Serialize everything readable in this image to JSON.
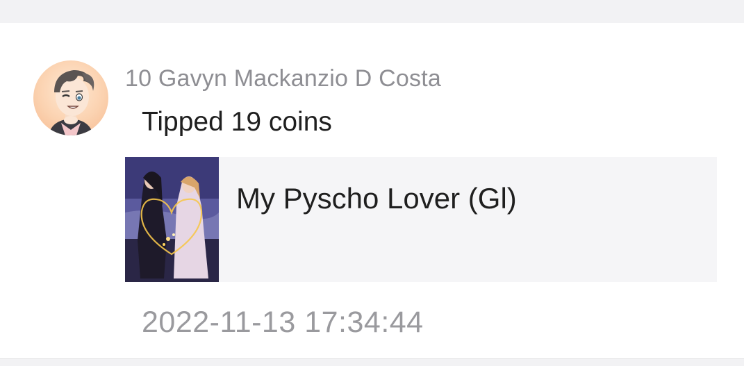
{
  "tip_item": {
    "user": {
      "name": "10 Gavyn Mackanzio D Costa",
      "avatar_icon": "cartoon-avatar-icon"
    },
    "message": "Tipped 19 coins",
    "book": {
      "title": "My Pyscho Lover (Gl)",
      "cover_icon": "book-cover-art"
    },
    "timestamp": "2022-11-13 17:34:44"
  },
  "colors": {
    "background": "#ffffff",
    "band": "#f2f2f4",
    "card": "#f5f5f7",
    "muted_text": "#8e8e93",
    "primary_text": "#1f1f1f"
  }
}
